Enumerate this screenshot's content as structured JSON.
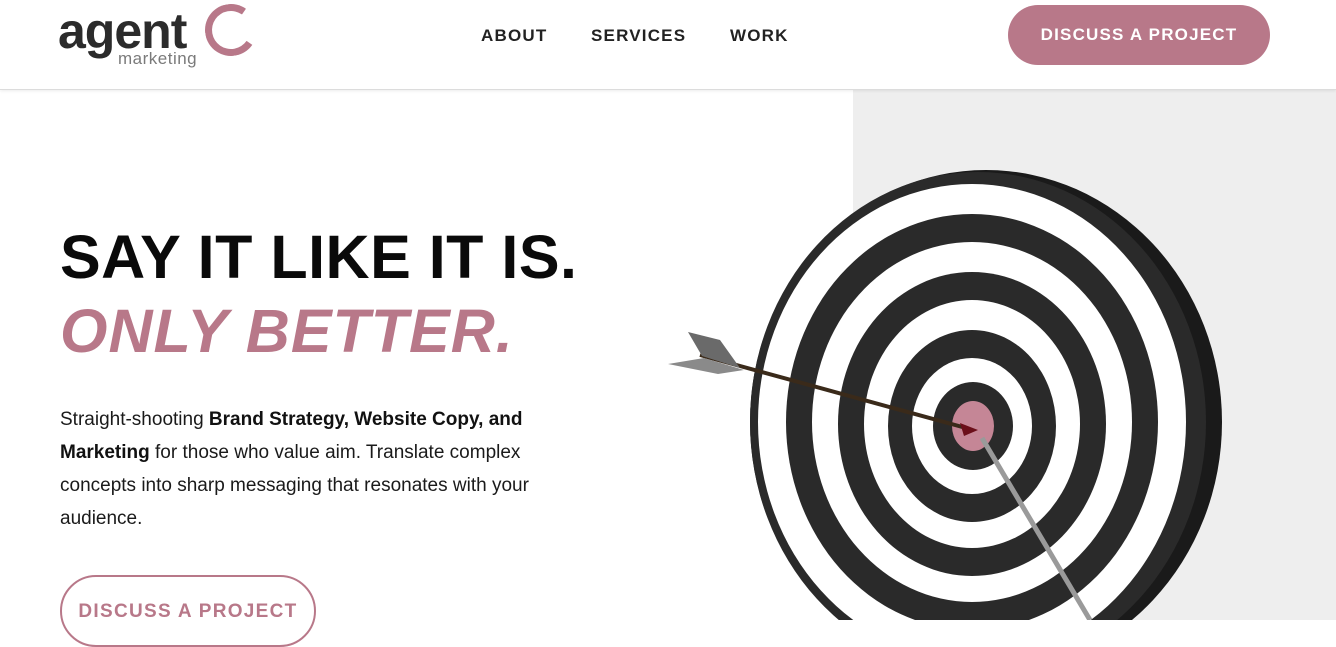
{
  "header": {
    "logo": {
      "main": "agent",
      "sub": "marketing"
    },
    "nav": [
      {
        "label": "ABOUT"
      },
      {
        "label": "SERVICES"
      },
      {
        "label": "WORK"
      }
    ],
    "cta_label": "DISCUSS A PROJECT"
  },
  "hero": {
    "title": "SAY IT LIKE IT IS.",
    "subtitle": "ONLY BETTER.",
    "description": {
      "part1": "Straight-shooting ",
      "bold1": "Brand Strategy, Website Copy, and Marketing",
      "part2": " for those who value aim. Translate complex concepts into sharp messaging that resonates with your audience."
    },
    "cta_label": "DISCUSS A PROJECT"
  },
  "colors": {
    "accent": "#b87889",
    "text": "#0a0a0a",
    "panel": "#eeeeee"
  },
  "image": {
    "icon": "target-with-arrow-icon"
  }
}
